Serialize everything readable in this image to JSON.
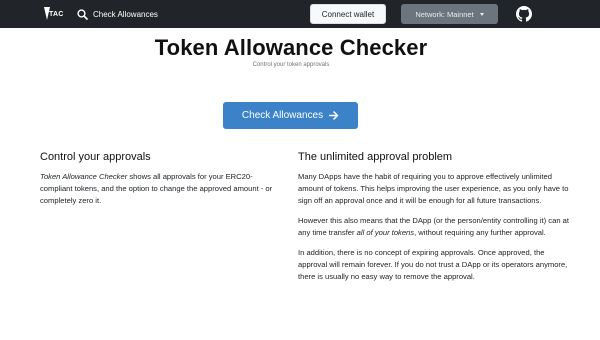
{
  "navbar": {
    "logo_text": "TAC",
    "search_label": "Check Allowances",
    "connect_label": "Connect wallet",
    "network_label": "Network: Mainnet",
    "icons": {
      "search": "search-icon",
      "github": "github-icon",
      "caret": "caret-down-icon"
    }
  },
  "header": {
    "title": "Token Allowance Checker",
    "subtitle": "Control your token approvals"
  },
  "cta": {
    "label": "Check Allowances",
    "icon": "arrow-right-icon",
    "color": "#3b82c9"
  },
  "left": {
    "heading": "Control your approvals",
    "p1_em": "Token Allowance Checker",
    "p1_rest": " shows all approvals for your ERC20-compliant tokens, and the option to change the approved amount - or completely zero it."
  },
  "right": {
    "heading": "The unlimited approval problem",
    "p1": "Many DApps have the habit of requiring you to approve effectively unlimited amount of tokens. This helps improving the user experience, as you only have to sign off an approval once and it will be enough for all future transactions.",
    "p2_a": "However this also means that the DApp (or the person/entity controlling it) can at any time transfer ",
    "p2_em": "all of your tokens",
    "p2_b": ", without requiring any further approval.",
    "p3": "In addition, there is no concept of expiring approvals. Once approved, the approval will remain forever. If you do not trust a DApp or its operators anymore, there is usually no easy way to remove the approval."
  },
  "colors": {
    "navbar": "#212529",
    "primary": "#3b82c9",
    "network_button": "#6c757d"
  }
}
